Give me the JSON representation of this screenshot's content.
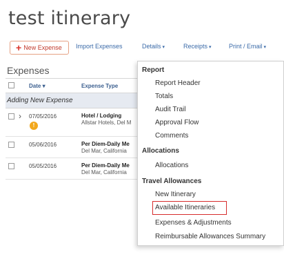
{
  "page": {
    "title": "test itinerary"
  },
  "toolbar": {
    "new_expense": "New Expense",
    "import_expenses": "Import Expenses",
    "details": "Details",
    "receipts": "Receipts",
    "print_email": "Print / Email",
    "caret": "▾"
  },
  "expenses": {
    "section_title": "Expenses",
    "columns": {
      "date": "Date ▾",
      "type": "Expense Type"
    },
    "group_label": "Adding New Expense",
    "rows": [
      {
        "date": "07/05/2016",
        "type": "Hotel / Lodging",
        "vendor": "Allstar Hotels, Del M"
      },
      {
        "date": "05/06/2016",
        "type": "Per Diem-Daily Me",
        "vendor": "Del Mar, California"
      },
      {
        "date": "05/05/2016",
        "type": "Per Diem-Daily Me",
        "vendor": "Del Mar, California"
      }
    ]
  },
  "menu": {
    "report": {
      "header": "Report",
      "items": [
        "Report Header",
        "Totals",
        "Audit Trail",
        "Approval Flow",
        "Comments"
      ]
    },
    "allocations": {
      "header": "Allocations",
      "items": [
        "Allocations"
      ]
    },
    "travel": {
      "header": "Travel Allowances",
      "items": [
        "New Itinerary",
        "Available Itineraries",
        "Expenses & Adjustments",
        "Reimbursable Allowances Summary"
      ]
    },
    "highlighted_item": "Available Itineraries"
  },
  "colors": {
    "highlight_border": "#d62b2b",
    "new_expense_border": "#e6a184",
    "link_blue": "#3a6aa8",
    "warning_badge": "#f2a81d"
  },
  "icons": {
    "plus": "plus-icon",
    "chevron": "chevron-right-icon",
    "warning": "receipt-warning-icon"
  }
}
